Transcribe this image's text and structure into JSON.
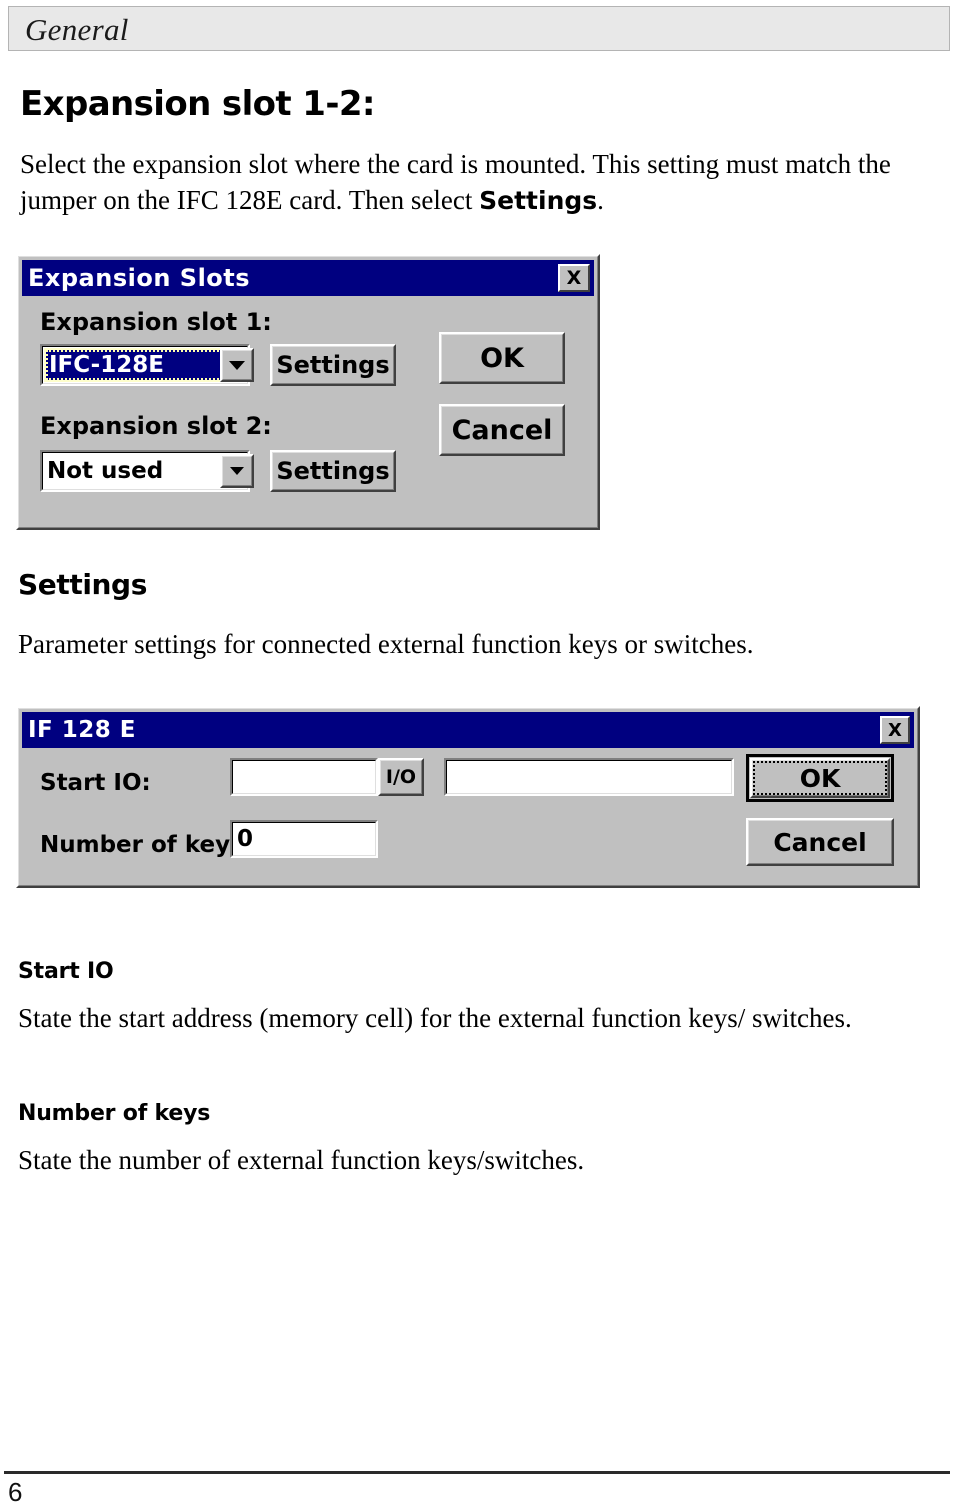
{
  "header": {
    "title": "General"
  },
  "sections": {
    "expansion": {
      "heading": "Expansion slot 1-2:",
      "body_part1": "Select the expansion slot where the card is mounted. This setting must match the jumper on the IFC 128E card. Then select ",
      "body_bold": "Settings",
      "body_part2": "."
    },
    "settings": {
      "heading": "Settings",
      "body": "Parameter settings for connected external function keys or switches."
    },
    "start_io": {
      "heading": "Start IO",
      "body": "State the start address (memory cell) for the external function keys/ switches."
    },
    "number_of_keys": {
      "heading": "Number of keys",
      "body": "State the number of external function keys/switches."
    }
  },
  "dialog_expansion_slots": {
    "title": "Expansion Slots",
    "close_label": "X",
    "slot1_label": "Expansion slot 1:",
    "slot1_value": "IFC-128E",
    "slot1_settings_label": "Settings",
    "slot2_label": "Expansion slot 2:",
    "slot2_value": "Not used",
    "slot2_settings_label": "Settings",
    "ok_label": "OK",
    "cancel_label": "Cancel",
    "dropdown_arrow_icon": "chevron-down-icon"
  },
  "dialog_if128e": {
    "title": "IF 128 E",
    "close_label": "X",
    "start_io_label": "Start IO:",
    "start_io_value": "",
    "io_button_label": "I/O",
    "address_value": "",
    "number_of_keys_label": "Number of keys:",
    "number_of_keys_value": "0",
    "ok_label": "OK",
    "cancel_label": "Cancel"
  },
  "footer": {
    "page_number": "6"
  },
  "colors": {
    "titlebar": "#000080",
    "dialog_face": "#c0c0c0",
    "header_band": "#e8e8e8",
    "selection_highlight": "#000080",
    "focus_border": "#ffffcc"
  }
}
